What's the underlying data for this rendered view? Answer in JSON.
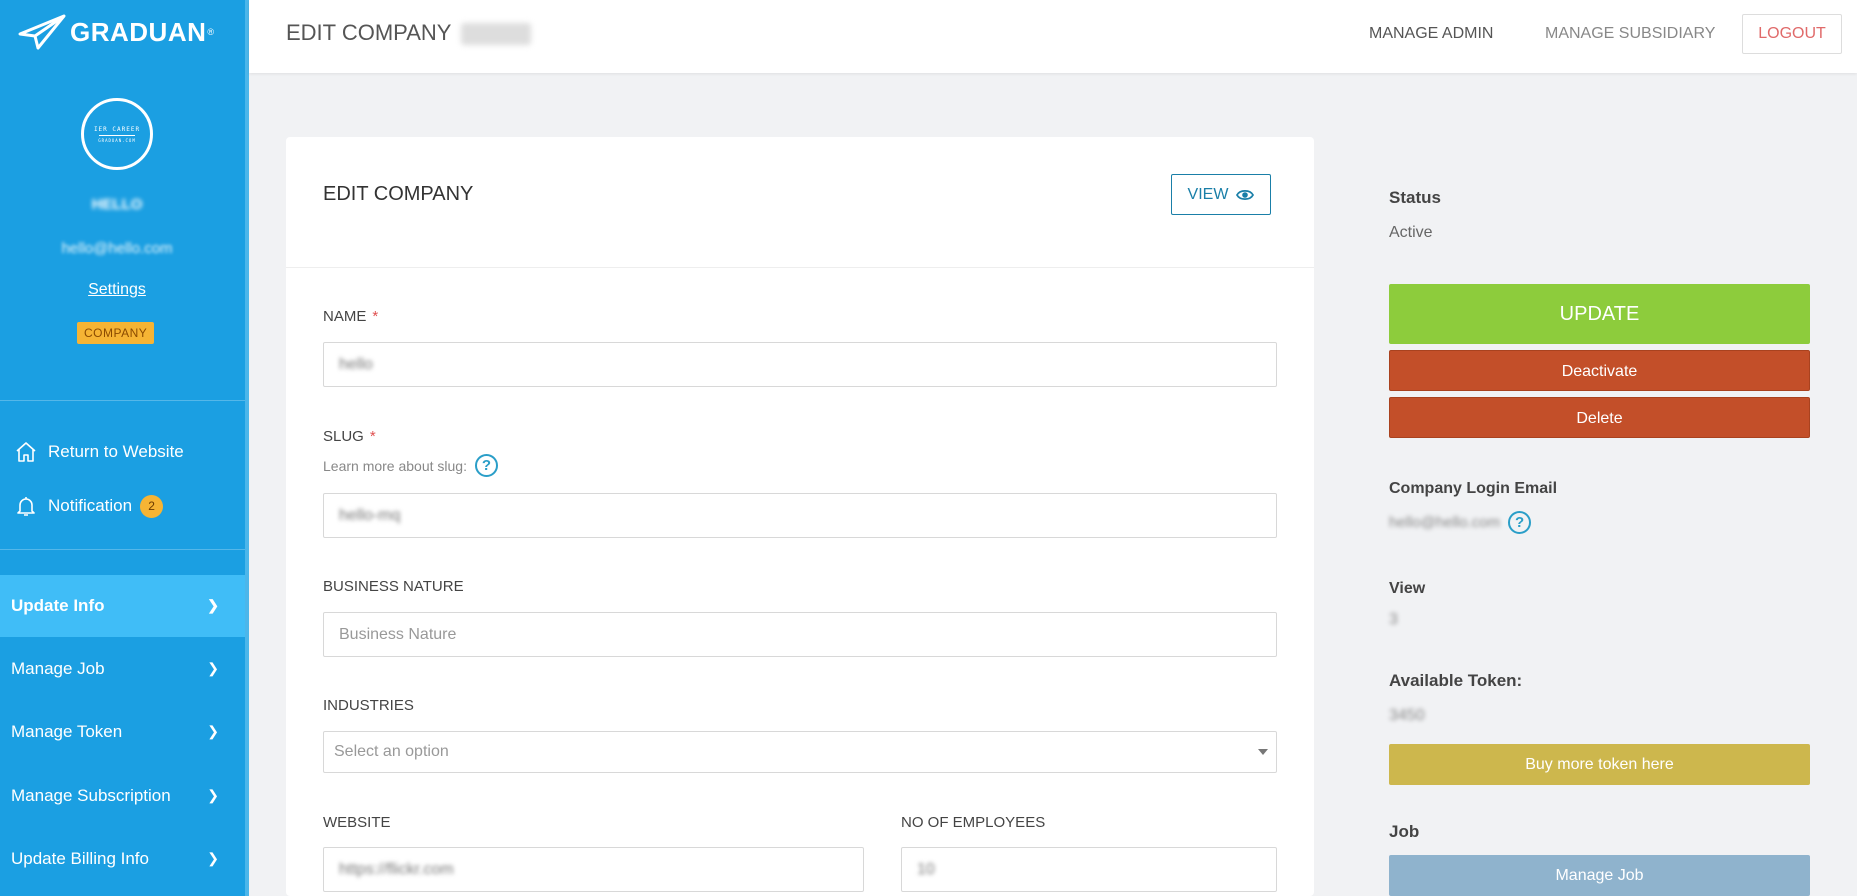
{
  "brand": {
    "name": "GRADUAN",
    "reg": "®"
  },
  "sidebar": {
    "avatar_text_top": "IER CAREER",
    "avatar_text_bottom": "GRADUAN.COM",
    "user_name": "HELLO",
    "user_email": "hello@hello.com",
    "settings_label": "Settings",
    "role_badge": "COMPANY",
    "return_label": "Return to Website",
    "notification_label": "Notification",
    "notification_count": "2",
    "nav": [
      {
        "label": "Update Info",
        "active": true
      },
      {
        "label": "Manage Job",
        "active": false
      },
      {
        "label": "Manage Token",
        "active": false
      },
      {
        "label": "Manage Subscription",
        "active": false
      },
      {
        "label": "Update Billing Info",
        "active": false
      }
    ]
  },
  "topbar": {
    "title": "EDIT COMPANY",
    "links": [
      "MANAGE ADMIN",
      "MANAGE SUBSIDIARY"
    ],
    "logout_label": "LOGOUT"
  },
  "form": {
    "title": "EDIT COMPANY",
    "view_label": "VIEW",
    "required_mark": "*",
    "name_label": "NAME",
    "name_value": "hello",
    "slug_label": "SLUG",
    "slug_hint": "Learn more about slug:",
    "slug_value": "hello-mq",
    "business_label": "BUSINESS NATURE",
    "business_placeholder": "Business Nature",
    "industries_label": "INDUSTRIES",
    "industries_placeholder": "Select an option",
    "website_label": "WEBSITE",
    "website_value": "https://flickr.com",
    "employees_label": "NO OF EMPLOYEES",
    "employees_value": "10",
    "help_glyph": "?"
  },
  "panel": {
    "status_label": "Status",
    "status_value": "Active",
    "update_label": "UPDATE",
    "deactivate_label": "Deactivate",
    "delete_label": "Delete",
    "login_email_label": "Company Login Email",
    "login_email_value": "hello@hello.com",
    "view_label": "View",
    "view_value": "3",
    "token_label": "Available Token:",
    "token_value": "3450",
    "buy_label": "Buy more token here",
    "job_label": "Job",
    "manage_job_label": "Manage Job"
  },
  "colors": {
    "sidebar": "#1b9fe2",
    "active_nav": "#40bdf7",
    "update": "#8dcc3c",
    "danger": "#c34f29",
    "buy": "#cdb74d",
    "manage_job": "#8fb3cd",
    "badge": "#f6b434"
  }
}
